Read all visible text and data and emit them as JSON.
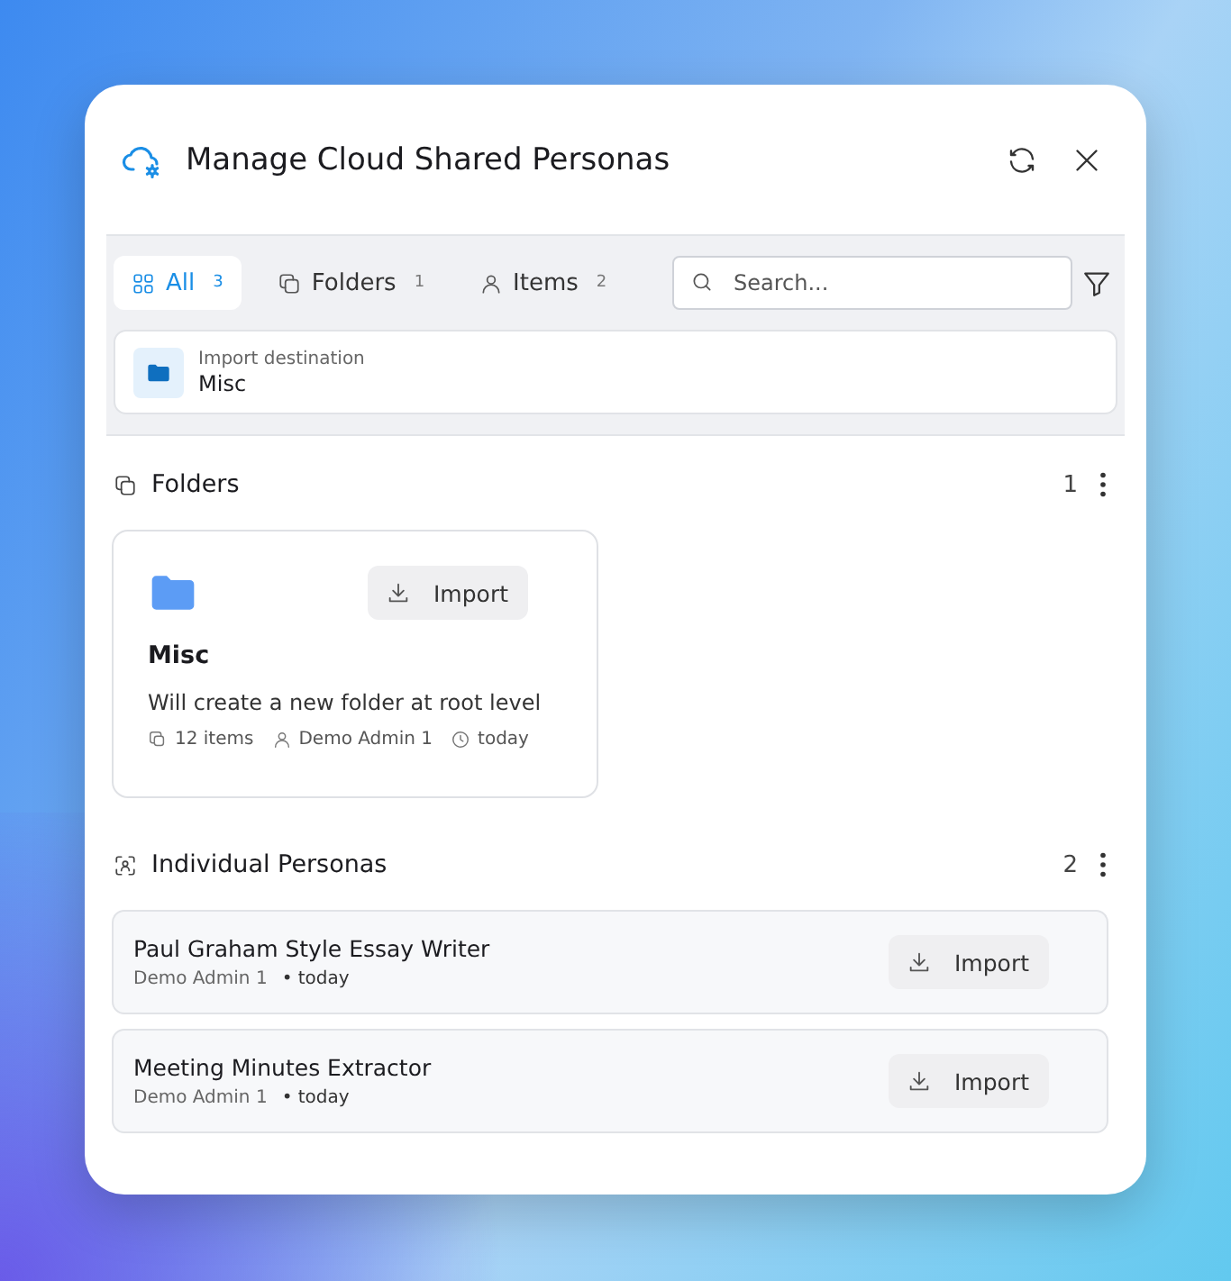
{
  "dialog": {
    "title": "Manage Cloud Shared Personas"
  },
  "tabs": [
    {
      "kind": "all",
      "label": "All",
      "count": "3",
      "selected": true
    },
    {
      "kind": "folders",
      "label": "Folders",
      "count": "1",
      "selected": false
    },
    {
      "kind": "items",
      "label": "Items",
      "count": "2",
      "selected": false
    }
  ],
  "search": {
    "placeholder": "Search..."
  },
  "destination": {
    "label": "Import destination",
    "value": "Misc"
  },
  "folders_section": {
    "title": "Folders",
    "count": "1",
    "folders": [
      {
        "name": "Misc",
        "description": "Will create a new folder at root level",
        "items": "12 items",
        "author": "Demo Admin 1",
        "time": "today",
        "button": "Import"
      }
    ]
  },
  "personas_section": {
    "title": "Individual Personas",
    "count": "2",
    "personas": [
      {
        "name": "Paul Graham Style Essay Writer",
        "author": "Demo Admin 1",
        "time": "• today",
        "button": "Import"
      },
      {
        "name": "Meeting Minutes Extractor",
        "author": "Demo Admin 1",
        "time": "• today",
        "button": "Import"
      }
    ]
  }
}
